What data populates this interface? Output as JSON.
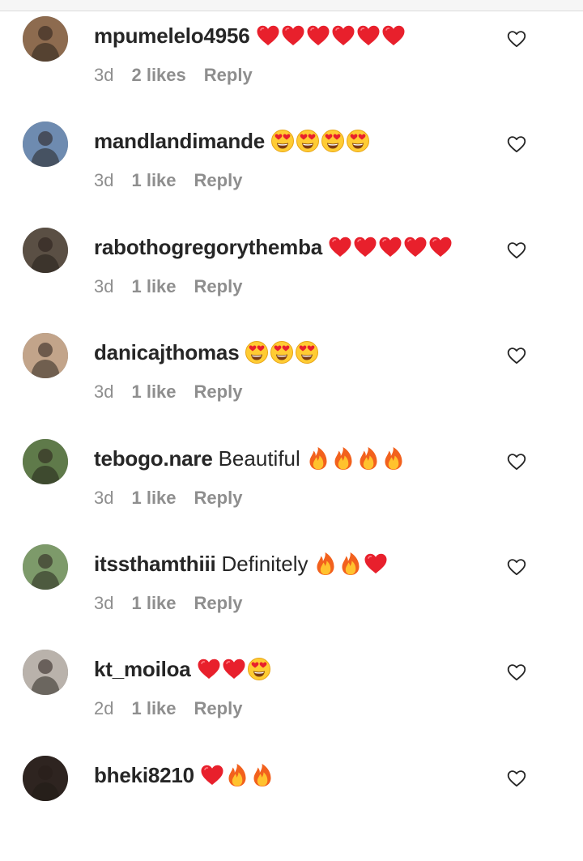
{
  "colors": {
    "text": "#262626",
    "meta": "#8e8e8e",
    "heart_red": "#e8202c",
    "fire_orange": "#f5a623"
  },
  "comments": [
    {
      "username": "mpumelelo4956",
      "text": "",
      "emojis": [
        "red-heart",
        "red-heart",
        "red-heart",
        "red-heart",
        "red-heart",
        "red-heart"
      ],
      "time": "3d",
      "likes": "2 likes",
      "reply": "Reply"
    },
    {
      "username": "mandlandimande",
      "text": "",
      "emojis": [
        "heart-eyes",
        "heart-eyes",
        "heart-eyes",
        "heart-eyes"
      ],
      "time": "3d",
      "likes": "1 like",
      "reply": "Reply"
    },
    {
      "username": "rabothogregorythemba",
      "text": "",
      "emojis": [
        "red-heart",
        "red-heart",
        "red-heart",
        "red-heart",
        "red-heart"
      ],
      "time": "3d",
      "likes": "1 like",
      "reply": "Reply"
    },
    {
      "username": "danicajthomas",
      "text": "",
      "emojis": [
        "heart-eyes",
        "heart-eyes",
        "heart-eyes"
      ],
      "time": "3d",
      "likes": "1 like",
      "reply": "Reply"
    },
    {
      "username": "tebogo.nare",
      "text": "Beautiful",
      "emojis": [
        "fire",
        "fire",
        "fire",
        "fire"
      ],
      "time": "3d",
      "likes": "1 like",
      "reply": "Reply"
    },
    {
      "username": "itssthamthiii",
      "text": "Definitely",
      "emojis": [
        "fire",
        "fire",
        "red-heart"
      ],
      "time": "3d",
      "likes": "1 like",
      "reply": "Reply"
    },
    {
      "username": "kt_moiloa",
      "text": "",
      "emojis": [
        "red-heart",
        "red-heart",
        "heart-eyes"
      ],
      "time": "2d",
      "likes": "1 like",
      "reply": "Reply"
    },
    {
      "username": "bheki8210",
      "text": "",
      "emojis": [
        "red-heart",
        "fire",
        "fire"
      ],
      "time": "",
      "likes": "",
      "reply": ""
    }
  ]
}
